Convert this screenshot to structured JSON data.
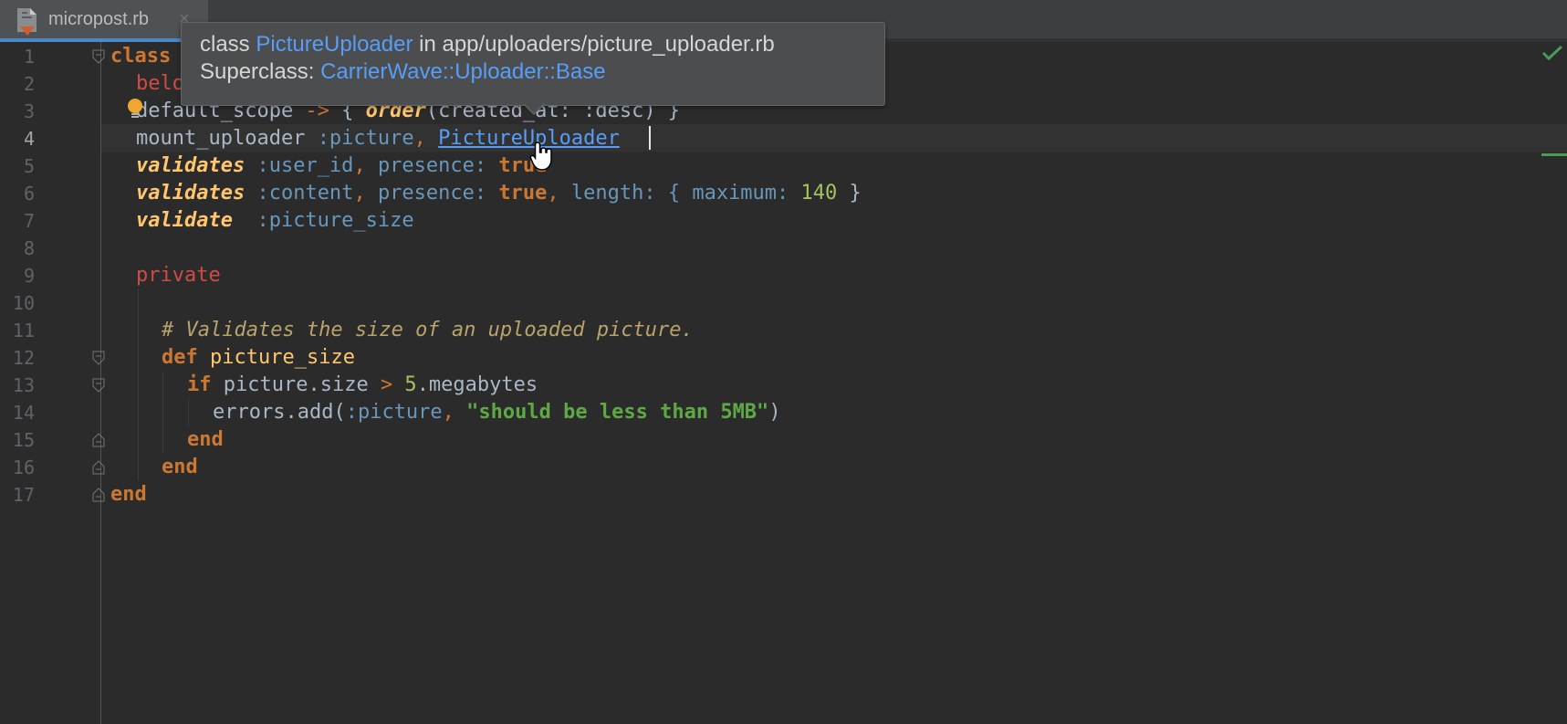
{
  "tab": {
    "filename": "micropost.rb",
    "close": "×",
    "icon": "ruby-file-icon"
  },
  "editor": {
    "current_line": 4,
    "line_numbers": [
      "1",
      "2",
      "3",
      "4",
      "5",
      "6",
      "7",
      "8",
      "9",
      "10",
      "11",
      "12",
      "13",
      "14",
      "15",
      "16",
      "17"
    ]
  },
  "code": {
    "l1_class": "class",
    "l2_belongs": "belo",
    "l3_default_scope": "default_scope",
    "l3_arrow": " -> ",
    "l3_open": "{ ",
    "l3_order": "order",
    "l3_args": "(created_at: :desc) }",
    "l4_mount": "mount_uploader ",
    "l4_sym": ":picture",
    "l4_comma": ", ",
    "l4_class": "PictureUploader",
    "l5_validates": "validates",
    "l5_sym": " :user_id",
    "l5_comma": ", ",
    "l5_key": "presence: ",
    "l5_val": "true",
    "l6_validates": "validates",
    "l6_sym": " :content",
    "l6_comma": ", ",
    "l6_key": "presence: ",
    "l6_val": "true",
    "l6_comma2": ", ",
    "l6_len": "length: { ",
    "l6_max": "maximum:",
    "l6_num": " 140",
    "l6_close": " }",
    "l7_validate": "validate",
    "l7_sym": "  :picture_size",
    "l9_private": "private",
    "l11_comment": "# Validates the size of an uploaded picture.",
    "l12_def": "def",
    "l12_name": " picture_size",
    "l13_if": "if",
    "l13_expr": " picture.size ",
    "l13_gt": ">",
    "l13_num": " 5",
    "l13_meth": ".megabytes",
    "l14_call": "errors.add(",
    "l14_sym": ":picture",
    "l14_comma": ", ",
    "l14_str": "\"should be less than 5MB\"",
    "l14_close": ")",
    "l15_end": "end",
    "l16_end": "end",
    "l17_end": "end"
  },
  "popup": {
    "prefix": "class ",
    "class_name": "PictureUploader",
    "location": " in app/uploaders/picture_uploader.rb",
    "superclass_label": "Superclass: ",
    "superclass": "CarrierWave::Uploader::Base"
  },
  "colors": {
    "background": "#2b2b2b",
    "keyword": "#cc7832",
    "symbol": "#6897bb",
    "link": "#589df6",
    "string": "#5ea845",
    "method": "#ffc66d"
  }
}
